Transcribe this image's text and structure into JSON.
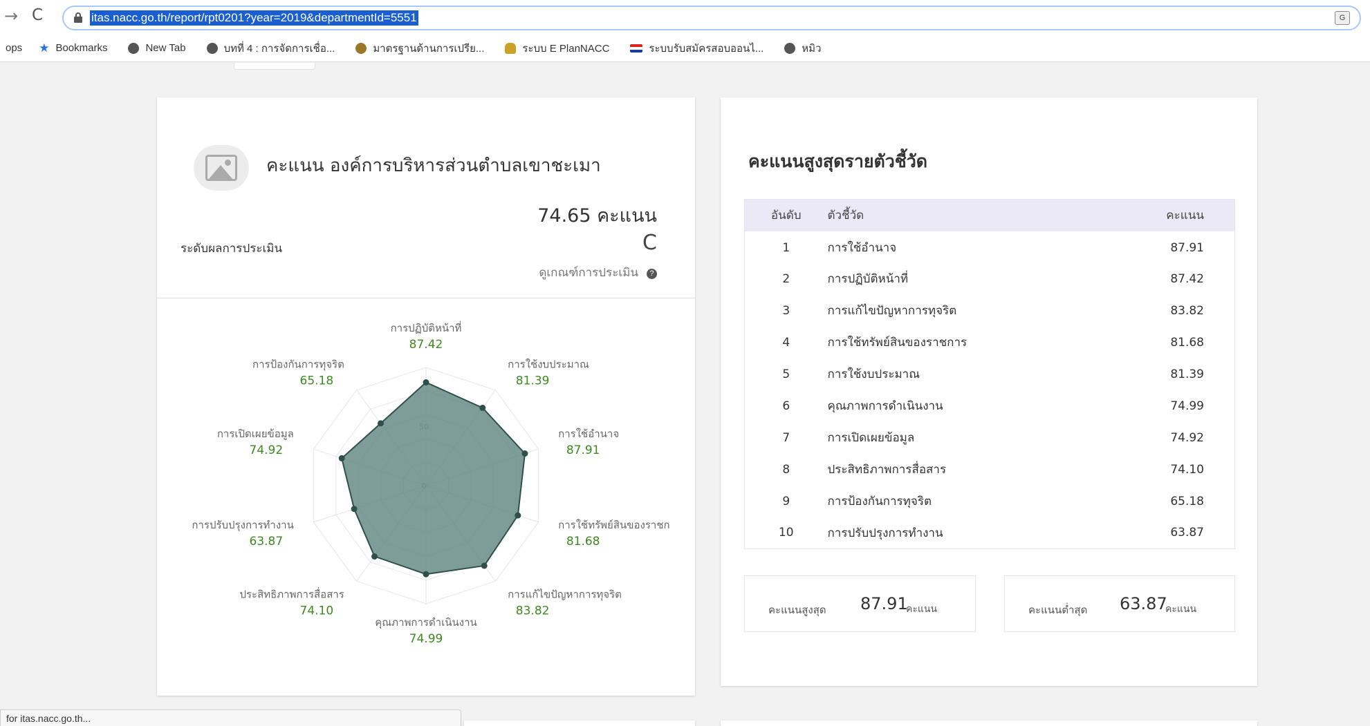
{
  "browser": {
    "url": "itas.nacc.go.th/report/rpt0201?year=2019&departmentId=5551",
    "bookmarks": [
      {
        "label": "ops",
        "icon": "apps-icon"
      },
      {
        "label": "Bookmarks",
        "icon": "star-icon"
      },
      {
        "label": "New Tab",
        "icon": "globe-icon"
      },
      {
        "label": "บทที่ 4 : การจัดการเชื่อ...",
        "icon": "globe-icon"
      },
      {
        "label": "มาตรฐานด้านการเปรีย...",
        "icon": "seal-icon"
      },
      {
        "label": "ระบบ E PlanNACC",
        "icon": "person-icon"
      },
      {
        "label": "ระบบรับสมัครสอบออนไ...",
        "icon": "flag-icon"
      },
      {
        "label": "หมิว",
        "icon": "globe-icon"
      }
    ],
    "status_text": "for itas.nacc.go.th..."
  },
  "summary": {
    "title": "คะแนน องค์การบริหารส่วนตำบลเขาชะเมา",
    "score_text": "74.65 คะแนน",
    "level_label": "ระดับผลการประเมิน",
    "grade": "C",
    "criteria_link": "ดูเกณฑ์การประเมิน"
  },
  "chart_data": {
    "type": "radar",
    "categories": [
      "การปฏิบัติหน้าที่",
      "การใช้งบประมาณ",
      "การใช้อำนาจ",
      "การใช้ทรัพย์สินของราชก",
      "การแก้ไขปัญหาการทุจริต",
      "คุณภาพการดำเนินงาน",
      "ประสิทธิภาพการสื่อสาร",
      "การปรับปรุงการทำงาน",
      "การเปิดเผยข้อมูล",
      "การป้องกันการทุจริต"
    ],
    "values": [
      87.42,
      81.39,
      87.91,
      81.68,
      83.82,
      74.99,
      74.1,
      63.87,
      74.92,
      65.18
    ],
    "value_labels": [
      "87.42",
      "81.39",
      "87.91",
      "81.68",
      "83.82",
      "74.99",
      "74.10",
      "63.87",
      "74.92",
      "65.18"
    ],
    "rlim": [
      0,
      100
    ],
    "ticks": [
      "0",
      "50"
    ],
    "fill_color": "#5b827b",
    "point_color": "#2f4f4a",
    "value_color": "#3d8a1f"
  },
  "ranking": {
    "title": "คะแนนสูงสุดรายตัวชี้วัด",
    "headers": {
      "rank": "อันดับ",
      "indicator": "ตัวชี้วัด",
      "score": "คะแนน"
    },
    "rows": [
      {
        "rank": "1",
        "indicator": "การใช้อำนาจ",
        "score": "87.91"
      },
      {
        "rank": "2",
        "indicator": "การปฏิบัติหน้าที่",
        "score": "87.42"
      },
      {
        "rank": "3",
        "indicator": "การแก้ไขปัญหาการทุจริต",
        "score": "83.82"
      },
      {
        "rank": "4",
        "indicator": "การใช้ทรัพย์สินของราชการ",
        "score": "81.68"
      },
      {
        "rank": "5",
        "indicator": "การใช้งบประมาณ",
        "score": "81.39"
      },
      {
        "rank": "6",
        "indicator": "คุณภาพการดำเนินงาน",
        "score": "74.99"
      },
      {
        "rank": "7",
        "indicator": "การเปิดเผยข้อมูล",
        "score": "74.92"
      },
      {
        "rank": "8",
        "indicator": "ประสิทธิภาพการสื่อสาร",
        "score": "74.10"
      },
      {
        "rank": "9",
        "indicator": "การป้องกันการทุจริต",
        "score": "65.18"
      },
      {
        "rank": "10",
        "indicator": "การปรับปรุงการทำงาน",
        "score": "63.87"
      }
    ],
    "max_label": "คะแนนสูงสุด",
    "max_value": "87.91",
    "min_label": "คะแนนต่ำสุด",
    "min_value": "63.87",
    "unit": "คะแนน"
  }
}
